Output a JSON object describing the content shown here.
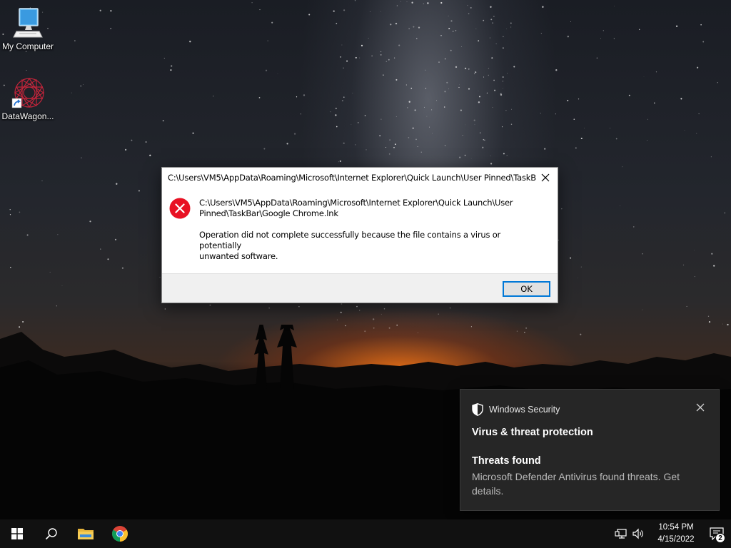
{
  "desktop": {
    "icons": [
      {
        "label": "My Computer",
        "icon": "computer-icon"
      },
      {
        "label": "DataWagon...",
        "icon": "datawagon-shortcut-icon"
      }
    ]
  },
  "dialog": {
    "title": "C:\\Users\\VM5\\AppData\\Roaming\\Microsoft\\Internet Explorer\\Quick Launch\\User Pinned\\TaskB...",
    "path_line1": "C:\\Users\\VM5\\AppData\\Roaming\\Microsoft\\Internet Explorer\\Quick Launch\\User",
    "path_line2": "Pinned\\TaskBar\\Google Chrome.lnk",
    "message_line1": "Operation did not complete successfully because the file contains a virus or potentially",
    "message_line2": "unwanted software.",
    "ok_label": "OK",
    "icon": "error-icon",
    "accent_color": "#0078d7",
    "error_color": "#e81123"
  },
  "toast": {
    "app_name": "Windows Security",
    "heading": "Virus & threat protection",
    "subheading": "Threats found",
    "body": "Microsoft Defender Antivirus found threats. Get details.",
    "icon": "shield-icon"
  },
  "taskbar": {
    "items": [
      "start-button",
      "search-button",
      "file-explorer",
      "chrome"
    ],
    "time": "10:54 PM",
    "date": "4/15/2022",
    "notification_count": "2"
  }
}
